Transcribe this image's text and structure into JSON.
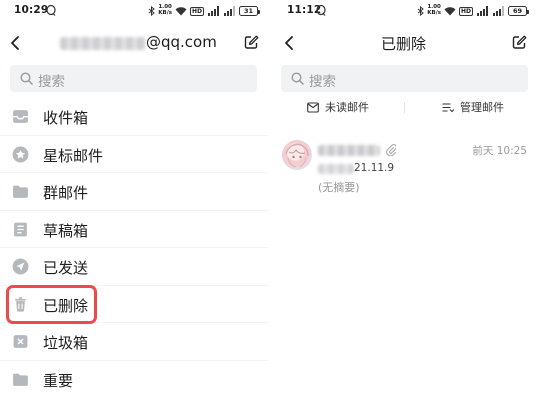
{
  "colors": {
    "highlight": "#ec4a4e",
    "icon_grey": "#b5b8bd",
    "search_bg": "#f1f2f4",
    "text_primary": "#1d1d1f",
    "text_secondary": "#999999"
  },
  "left": {
    "status_bar": {
      "time": "10:29",
      "net_speed": "1.00",
      "net_unit": "KB/s",
      "hd_badge": "HD",
      "battery": "31",
      "icons": [
        "qq-notification-icon",
        "bluetooth-icon",
        "wifi-icon",
        "signal-icon",
        "signal-icon",
        "battery-icon"
      ]
    },
    "header": {
      "back_icon": "chevron-left-icon",
      "account_suffix": "@qq.com",
      "compose_icon": "compose-icon"
    },
    "search": {
      "icon": "search-icon",
      "placeholder": "搜索"
    },
    "folders": [
      {
        "label": "收件箱",
        "icon": "inbox-icon"
      },
      {
        "label": "星标邮件",
        "icon": "star-icon"
      },
      {
        "label": "群邮件",
        "icon": "folder-icon"
      },
      {
        "label": "草稿箱",
        "icon": "draft-icon"
      },
      {
        "label": "已发送",
        "icon": "sent-icon"
      },
      {
        "label": "已删除",
        "icon": "trash-icon",
        "highlighted": true
      },
      {
        "label": "垃圾箱",
        "icon": "spam-icon"
      },
      {
        "label": "重要",
        "icon": "folder-icon"
      }
    ]
  },
  "right": {
    "status_bar": {
      "time": "11:12",
      "net_speed": "1.00",
      "net_unit": "KB/s",
      "hd_badge": "HD",
      "battery": "69",
      "icons": [
        "qq-notification-icon",
        "bluetooth-icon",
        "wifi-icon",
        "signal-icon",
        "signal-icon",
        "battery-icon"
      ]
    },
    "header": {
      "back_icon": "chevron-left-icon",
      "title": "已删除",
      "compose_icon": "compose-icon"
    },
    "search": {
      "icon": "search-icon",
      "placeholder": "搜索"
    },
    "filters": {
      "unread_icon": "envelope-icon",
      "unread_label": "未读邮件",
      "manage_icon": "list-manage-icon",
      "manage_label": "管理邮件"
    },
    "mail": {
      "avatar_icon": "anime-avatar",
      "has_attachment": true,
      "time": "前天 10:25",
      "subject_suffix": "21.11.9",
      "preview": "(无摘要)"
    }
  }
}
